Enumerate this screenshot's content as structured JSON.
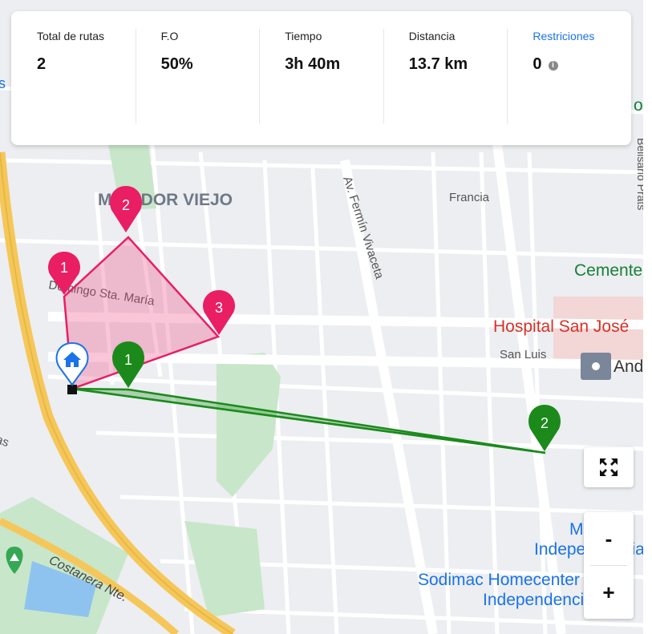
{
  "stats": [
    {
      "label": "Total de rutas",
      "value": "2"
    },
    {
      "label": "F.O",
      "value": "50%"
    },
    {
      "label": "Tiempo",
      "value": "3h 40m"
    },
    {
      "label": "Distancia",
      "value": "13.7 km"
    },
    {
      "label": "Restriciones",
      "value": "0",
      "link": true,
      "info_icon": "info-icon"
    }
  ],
  "map_labels": {
    "neighborhood": "MIRADOR VIEJO",
    "street_francia": "Francia",
    "street_fermin": "Av. Fermín Vivaceta",
    "street_domingo": "Domingo Sta. María",
    "street_san_luis": "San Luis",
    "street_costanera": "Costanera Nte.",
    "street_belisario": "Belisario Prats",
    "place_cement": "Cementerio",
    "place_hospital": "Hospital San José",
    "place_andes": "Andes",
    "place_mall": "Mall",
    "place_indep": "Independencia",
    "place_sodimac": "Sodimac Homecenter",
    "place_sodimac2": "Independencia",
    "edge_left_top": "s",
    "edge_left_mid": "as",
    "edge_right_top": "o"
  },
  "routes": [
    {
      "name": "pink",
      "color": "#e91e63",
      "fill": "rgba(236,64,122,0.30)",
      "stops": [
        "1",
        "2",
        "3"
      ]
    },
    {
      "name": "green",
      "color": "#1b8a1b",
      "fill": "rgba(27,138,27,0.30)",
      "stops": [
        "1",
        "2"
      ]
    }
  ],
  "depot_icon": "home-icon",
  "controls": {
    "fullscreen_icon": "fullscreen-icon",
    "zoom_out": "-",
    "zoom_in": "+"
  },
  "colors": {
    "highway": "#f5c75a",
    "park": "#c8e6c9",
    "water": "#8ec3f0",
    "hospital": "#d93025",
    "poi_blue": "#1a73e8",
    "poi_green": "#188038"
  }
}
